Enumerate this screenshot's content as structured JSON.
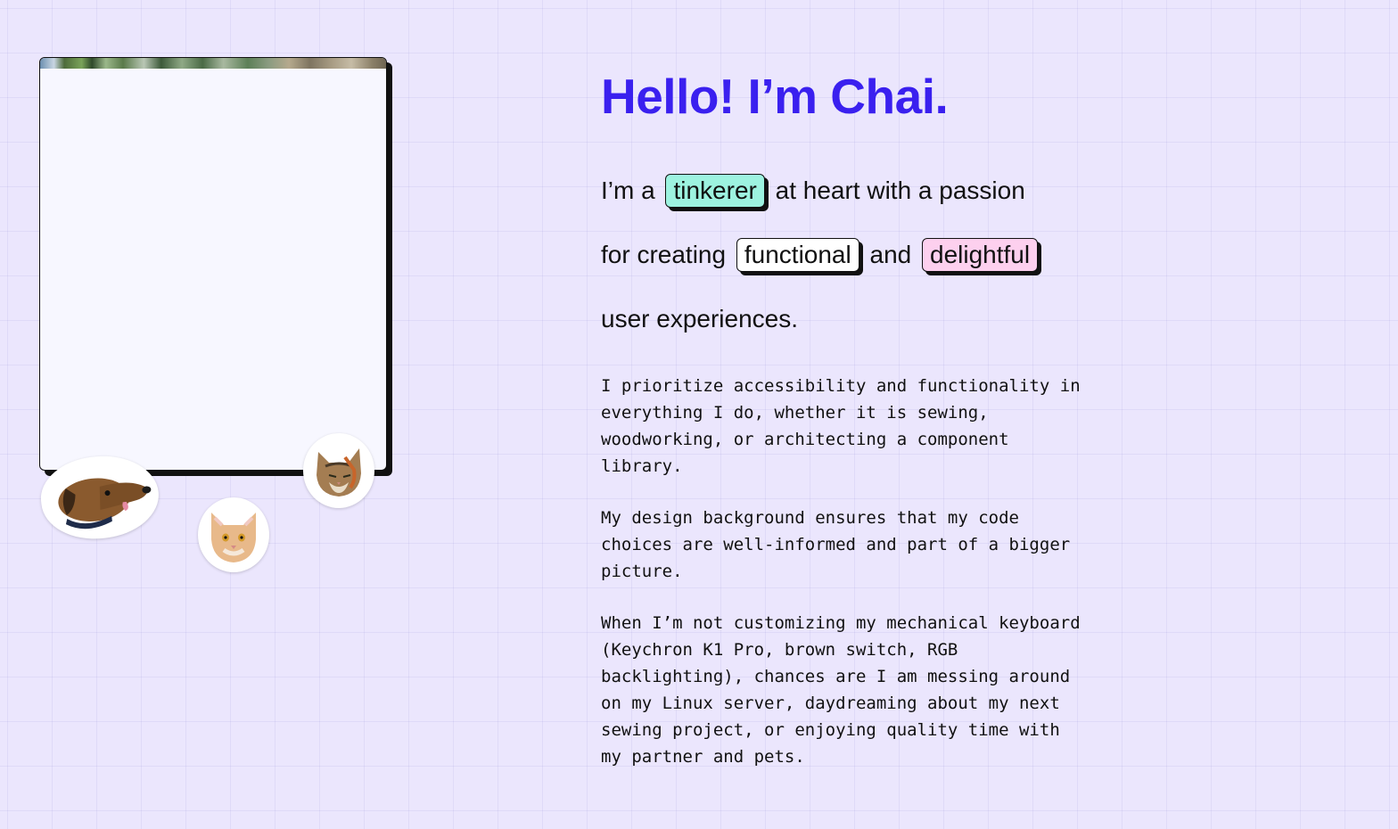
{
  "profile": {
    "headline": "Hello! I’m Chai.",
    "intro": {
      "line1_before": "I’m a",
      "chip_tinkerer": "tinkerer",
      "line1_after": "at heart with a passion",
      "line2_before": "for creating",
      "chip_functional": "functional",
      "line2_mid": "and",
      "chip_delightful": "delightful",
      "line3": "user experiences."
    },
    "bio": [
      "I prioritize accessibility and functionality in everything I do, whether it is sewing, woodworking, or architecting a component library.",
      "My design background ensures that my code choices are well-informed and part of a bigger picture.",
      "When I’m not customizing my mechanical keyboard (Keychron K1 Pro, brown switch, RGB backlighting), chances are I am messing around on my Linux server, daydreaming about my next sewing project, or enjoying quality time with my partner and pets."
    ]
  },
  "colors": {
    "background": "#ebe6fd",
    "headline": "#3a20ef",
    "chip_tinkerer": "#9df3e0",
    "chip_functional": "#ffffff",
    "chip_delightful": "#fdd0ee"
  },
  "stickers": [
    "dog-sticker-icon",
    "tabby-cat-sticker-icon",
    "orange-cat-sticker-icon"
  ]
}
